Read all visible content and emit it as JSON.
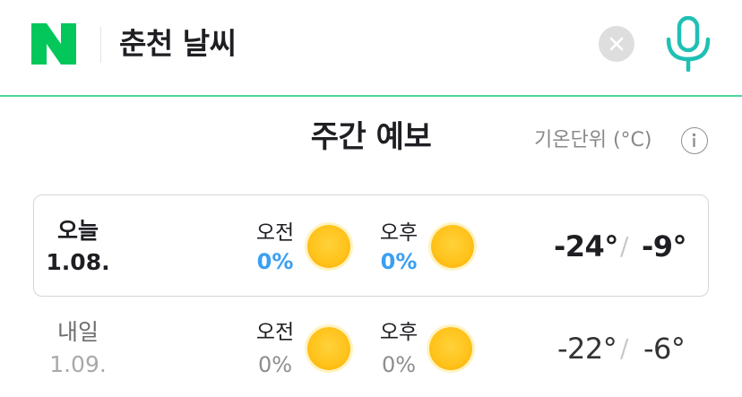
{
  "search": {
    "query": "춘천 날씨"
  },
  "colors": {
    "brand_green": "#03c75a",
    "accent_line": "#4cd69b",
    "rain_blue": "#3a9ff2"
  },
  "forecast": {
    "title": "주간 예보",
    "unit_label": "기온단위 (°C)",
    "days": [
      {
        "day": "오늘",
        "date": "1.08.",
        "am_label": "오전",
        "am_rain": "0%",
        "am_icon": "sun-icon",
        "pm_label": "오후",
        "pm_rain": "0%",
        "pm_icon": "sun-icon",
        "low": "-24°",
        "high": "-9°"
      },
      {
        "day": "내일",
        "date": "1.09.",
        "am_label": "오전",
        "am_rain": "0%",
        "am_icon": "sun-icon",
        "pm_label": "오후",
        "pm_rain": "0%",
        "pm_icon": "sun-icon",
        "low": "-22°",
        "high": "-6°"
      }
    ]
  }
}
